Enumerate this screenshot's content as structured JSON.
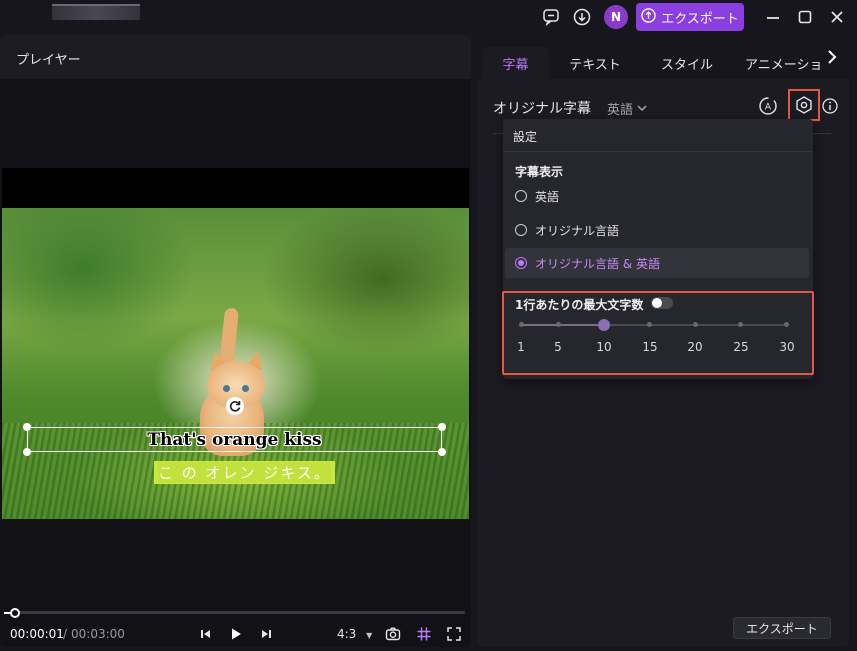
{
  "topbar": {
    "avatar_initial": "N",
    "export_label": "エクスポート",
    "icons": [
      "feedback-icon",
      "download-icon",
      "upload-icon",
      "minimize-icon",
      "maximize-icon",
      "close-icon"
    ]
  },
  "player": {
    "title": "プレイヤー",
    "caption_en": "That's orange kiss",
    "caption_ja": "こ の オレン ジキス。",
    "time_current": "00:00:01",
    "time_separator": "/",
    "time_total": "00:03:00",
    "aspect_ratio": "4:3",
    "progress": 0.01
  },
  "panel": {
    "tabs": [
      "字幕",
      "テキスト",
      "スタイル",
      "アニメーショ"
    ],
    "active_tab": "字幕",
    "subtitle_label": "オリジナル字幕",
    "language": "英語",
    "footer_export": "エクスポート"
  },
  "settings": {
    "title": "設定",
    "display_section": "字幕表示",
    "options": [
      "英語",
      "オリジナル言語",
      "オリジナル言語 & 英語"
    ],
    "selected_option": "オリジナル言語 & 英語",
    "max_chars_label": "1行あたりの最大文字数",
    "max_chars_enabled": false,
    "slider_ticks": [
      "1",
      "5",
      "10",
      "15",
      "20",
      "25",
      "30"
    ],
    "slider_value": 10
  },
  "colors": {
    "accent": "#8b3fe0",
    "accent_text": "#b77cf5",
    "highlight": "#e2584b",
    "caption_ja_bg": "#c6ea3d"
  }
}
